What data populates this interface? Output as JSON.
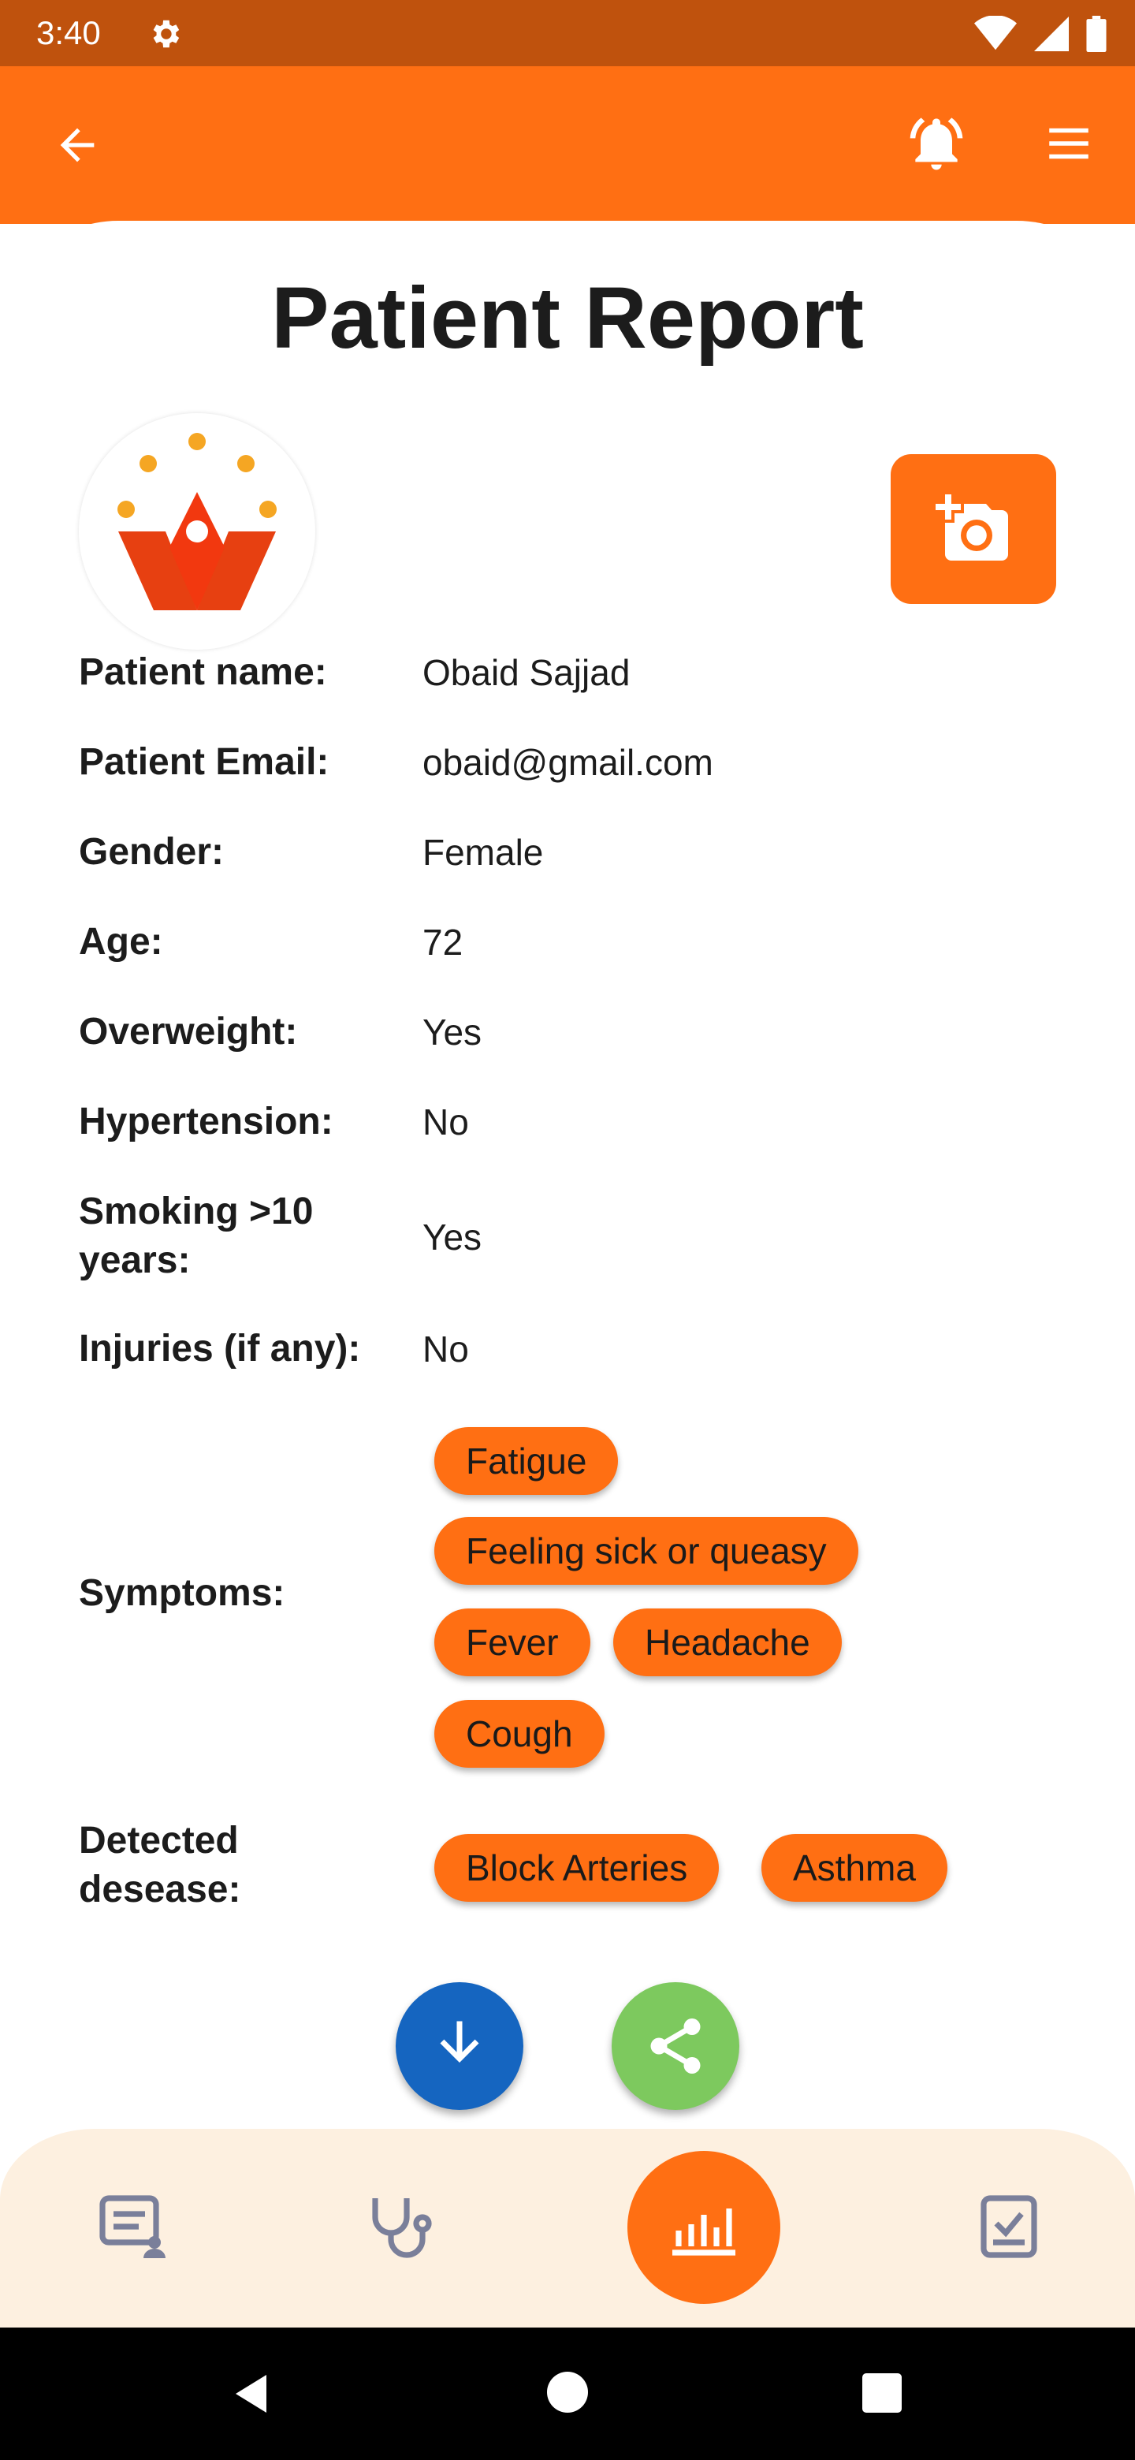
{
  "status_bar": {
    "time": "3:40"
  },
  "screen": {
    "title": "Patient Report"
  },
  "patient": {
    "fields": [
      {
        "label": "Patient name:",
        "value": "Obaid Sajjad"
      },
      {
        "label": "Patient Email:",
        "value": "obaid@gmail.com"
      },
      {
        "label": "Gender:",
        "value": "Female"
      },
      {
        "label": "Age:",
        "value": "72"
      },
      {
        "label": "Overweight:",
        "value": "Yes"
      },
      {
        "label": "Hypertension:",
        "value": "No"
      },
      {
        "label": "Smoking >10 years:",
        "value": "Yes"
      },
      {
        "label": "Injuries (if any):",
        "value": "No"
      }
    ],
    "symptoms_label": "Symptoms:",
    "symptoms": [
      "Fatigue",
      "Feeling sick or queasy",
      "Fever",
      "Headache",
      "Cough"
    ],
    "disease_label": "Detected desease:",
    "diseases": [
      "Block Arteries",
      "Asthma"
    ]
  },
  "colors": {
    "status_bar": "#BF520D",
    "accent": "#FF6F13",
    "download_fab": "#1565C0",
    "share_fab": "#7DC95E",
    "bottom_nav_bg": "#FDF0E0",
    "nav_icon": "#7A7F9A"
  },
  "icons": {
    "back": "arrow-left-icon",
    "alarm": "bell-ring-icon",
    "menu": "hamburger-icon",
    "camera": "add-photo-icon",
    "download": "download-icon",
    "share": "share-icon",
    "nav": [
      "report-user-icon",
      "stethoscope-icon",
      "analytics-icon",
      "checklist-icon"
    ]
  }
}
